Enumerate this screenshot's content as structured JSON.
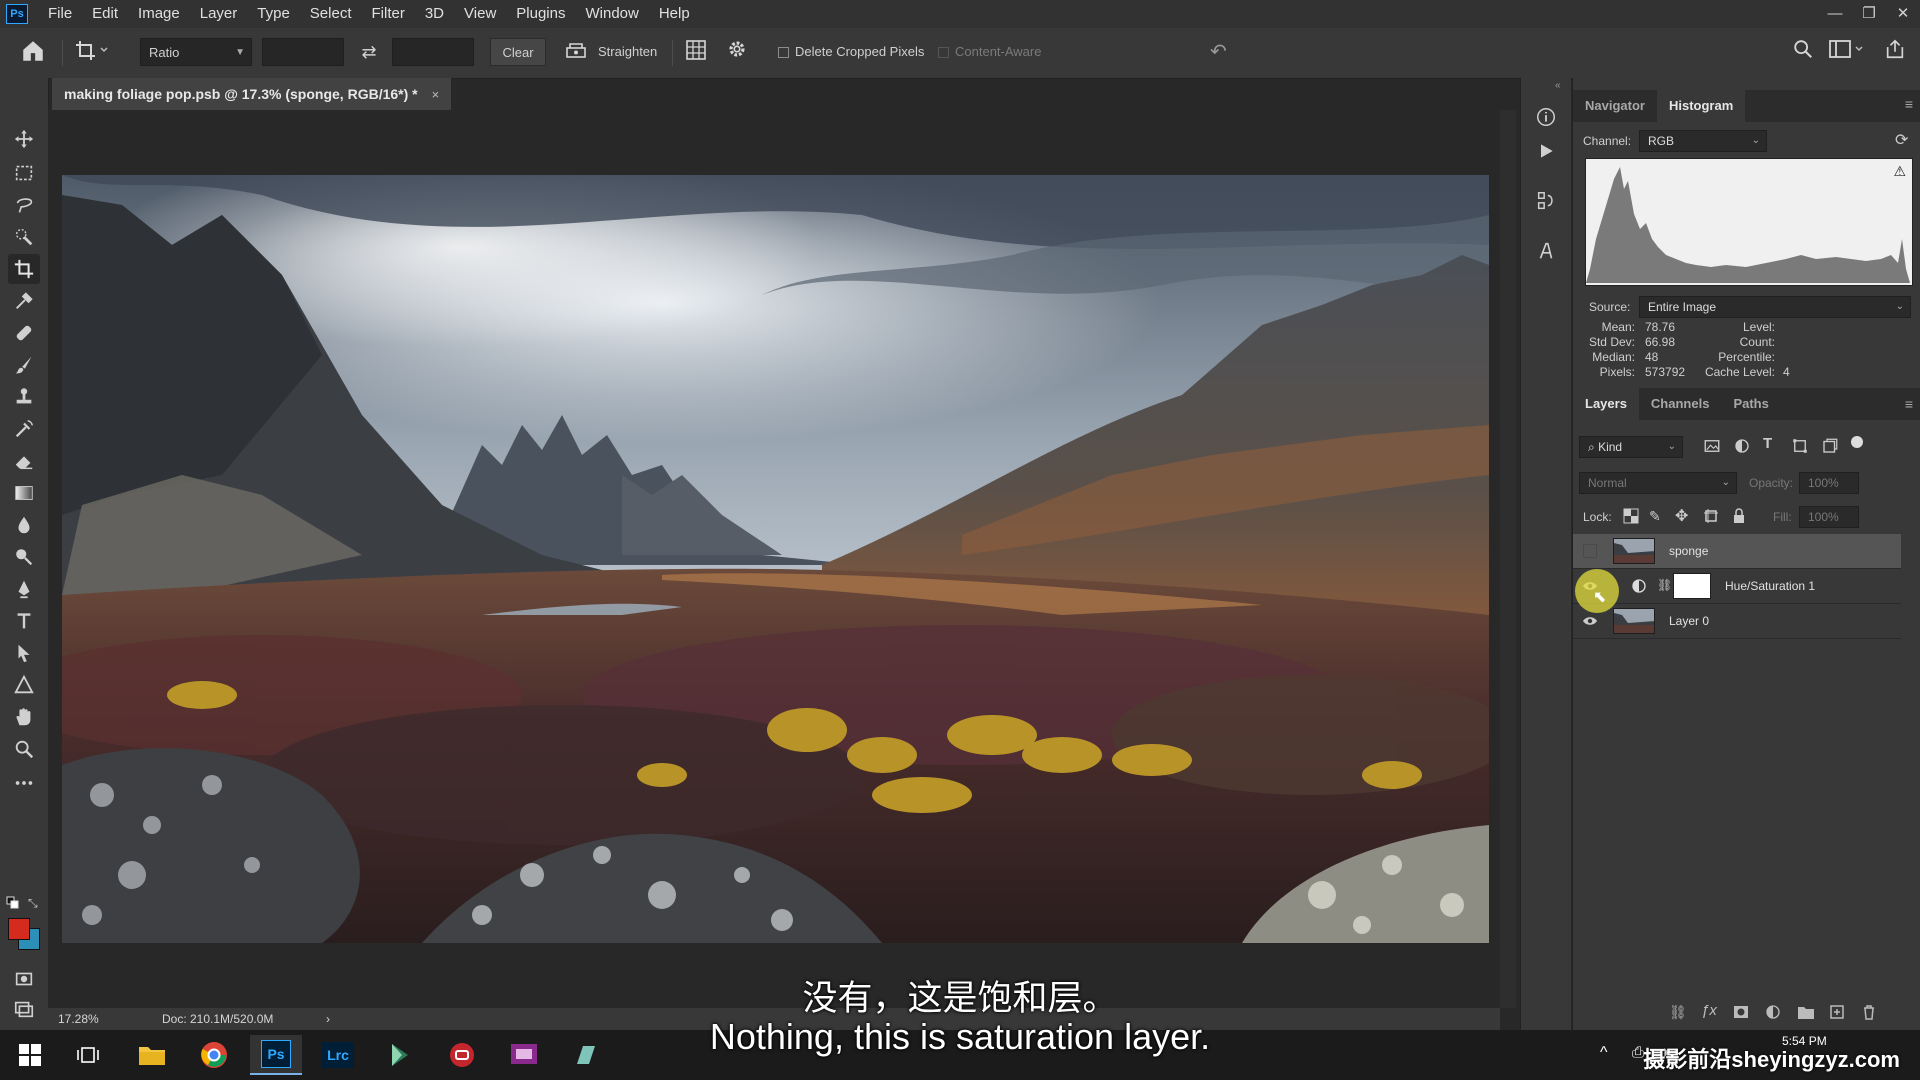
{
  "app": {
    "logo": "Ps",
    "menu": [
      "File",
      "Edit",
      "Image",
      "Layer",
      "Type",
      "Select",
      "Filter",
      "3D",
      "View",
      "Plugins",
      "Window",
      "Help"
    ],
    "window_controls": [
      "—",
      "❐",
      "✕"
    ]
  },
  "options_bar": {
    "ratio_label": "Ratio",
    "clear_label": "Clear",
    "straighten_label": "Straighten",
    "delete_cropped_label": "Delete Cropped Pixels",
    "content_aware_label": "Content-Aware"
  },
  "document": {
    "tab_title": "making foliage pop.psb @ 17.3% (sponge, RGB/16*) *",
    "close_glyph": "×",
    "zoom": "17.28%",
    "doc_size": "Doc: 210.1M/520.0M",
    "status_arrow": "›"
  },
  "histogram_panel": {
    "tabs": [
      "Navigator",
      "Histogram"
    ],
    "channel_label": "Channel:",
    "channel_value": "RGB",
    "source_label": "Source:",
    "source_value": "Entire Image",
    "stats_left": [
      {
        "k": "Mean:",
        "v": "78.76"
      },
      {
        "k": "Std Dev:",
        "v": "66.98"
      },
      {
        "k": "Median:",
        "v": "48"
      },
      {
        "k": "Pixels:",
        "v": "573792"
      }
    ],
    "stats_right": [
      {
        "k": "Level:",
        "v": ""
      },
      {
        "k": "Count:",
        "v": ""
      },
      {
        "k": "Percentile:",
        "v": ""
      },
      {
        "k": "Cache Level:",
        "v": "4"
      }
    ]
  },
  "layers_panel": {
    "tabs": [
      "Layers",
      "Channels",
      "Paths"
    ],
    "filter_kind": "Kind",
    "blend_mode": "Normal",
    "opacity_label": "Opacity:",
    "opacity_value": "100%",
    "lock_label": "Lock:",
    "fill_label": "Fill:",
    "fill_value": "100%",
    "layers": [
      {
        "name": "sponge",
        "visible": false,
        "selected": true
      },
      {
        "name": "Hue/Saturation 1",
        "visible": true,
        "selected": false
      },
      {
        "name": "Layer 0",
        "visible": true,
        "selected": false
      }
    ]
  },
  "subtitles": {
    "chinese": "没有，这是饱和层。",
    "english": "Nothing, this is saturation layer."
  },
  "taskbar": {
    "apps": [
      "start",
      "task-view",
      "file-explorer",
      "chrome",
      "photoshop",
      "lightroom-classic",
      "app-green",
      "app-red",
      "app-purple",
      "app-teal"
    ],
    "ps_label": "Ps",
    "lrc_label": "Lrc",
    "clock": "5:54 PM"
  },
  "watermark": "摄影前沿sheyingzyz.com",
  "colors": {
    "foreground": "#d42b1e",
    "background": "#2b8fb8",
    "accent": "#31a8ff"
  }
}
